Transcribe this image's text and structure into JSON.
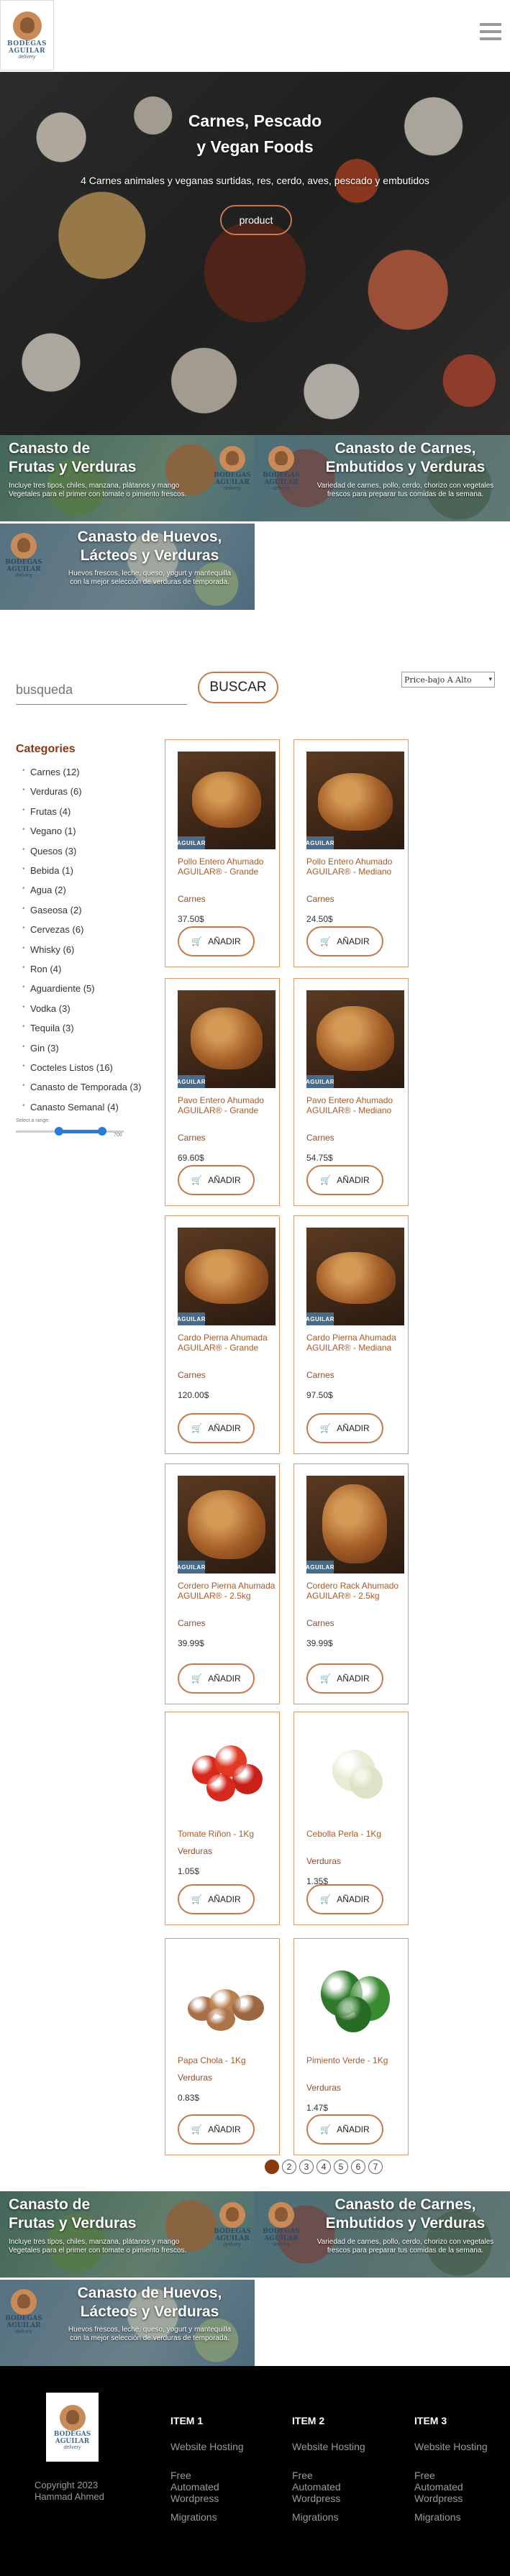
{
  "header": {
    "brand_line1": "BODEGAS",
    "brand_line2": "AGUILAR",
    "brand_line3": "delivery"
  },
  "hero": {
    "title_line1": "Carnes, Pescado",
    "title_line2": "y Vegan Foods",
    "subtitle": "4 Carnes animales y veganas surtidas, res, cerdo, aves, pescado y embutidos",
    "button_label": "product"
  },
  "banners": {
    "fruit": {
      "title_line1": "Canasto de",
      "title_line2": "Frutas y Verduras",
      "subtitle_line1": "Incluye tres tipos, chiles, manzana, plátanos y mango",
      "subtitle_line2": "Vegetales para el primer con tomate o pimiento frescos."
    },
    "meat": {
      "title_line1": "Canasto de Carnes,",
      "title_line2": "Embutidos y Verduras",
      "subtitle_line1": "Variedad de carnes, pollo, cerdo, chorizo con vegetales",
      "subtitle_line2": "frescos para preparar tus comidas de la semana."
    },
    "egg": {
      "title_line1": "Canasto de Huevos,",
      "title_line2": "Lácteos y Verduras",
      "subtitle_line1": "Huevos frescos, leche, queso, yogurt y mantequilla",
      "subtitle_line2": "con la mejor selección de verduras de temporada."
    }
  },
  "search": {
    "placeholder": "busqueda",
    "button_label": "BUSCAR"
  },
  "sort": {
    "selected": "Price-bajo A Alto"
  },
  "categories": {
    "heading": "Categories",
    "items": [
      "Carnes (12)",
      "Verduras (6)",
      "Frutas (4)",
      "Vegano (1)",
      "Quesos (3)",
      "Bebida (1)",
      "Agua (2)",
      "Gaseosa (2)",
      "Cervezas (6)",
      "Whisky (6)",
      "Ron (4)",
      "Aguardiente (5)",
      "Vodka (3)",
      "Tequila (3)",
      "Gin (3)",
      "Cocteles Listos (16)",
      "Canasto de Temporada (3)",
      "Canasto Semanal (4)"
    ],
    "slider_label": "Select a range:",
    "slider_max": "700",
    "slider_low": 0.4,
    "slider_high": 0.8
  },
  "products": [
    {
      "name": "Pollo Entero Ahumado AGUILAR® - Grande",
      "category": "Carnes",
      "price": "37.50$",
      "add": "AÑADIR",
      "badge": "AGUILAR"
    },
    {
      "name": "Pollo Entero Ahumado AGUILAR® - Mediano",
      "category": "Carnes",
      "price": "24.50$",
      "add": "AÑADIR",
      "badge": "AGUILAR"
    },
    {
      "name": "Pavo Entero Ahumado AGUILAR® - Grande",
      "category": "Carnes",
      "price": "69.60$",
      "add": "AÑADIR",
      "badge": "AGUILAR"
    },
    {
      "name": "Pavo Entero Ahumado AGUILAR® - Mediano",
      "category": "Carnes",
      "price": "54.75$",
      "add": "AÑADIR",
      "badge": "AGUILAR"
    },
    {
      "name": "Cardo Pierna Ahumada AGUILAR® - Grande",
      "category": "Carnes",
      "price": "120.00$",
      "add": "AÑADIR",
      "badge": "AGUILAR"
    },
    {
      "name": "Cardo Pierna Ahumada AGUILAR® - Mediana",
      "category": "Carnes",
      "price": "97.50$",
      "add": "AÑADIR",
      "badge": "AGUILAR"
    },
    {
      "name": "Cordero Pierna Ahumada AGUILAR® - 2.5kg",
      "category": "Carnes",
      "price": "39.99$",
      "add": "AÑADIR",
      "badge": "AGUILAR"
    },
    {
      "name": "Cordero Rack Ahumado AGUILAR® - 2.5kg",
      "category": "Carnes",
      "price": "39.99$",
      "add": "AÑADIR",
      "badge": "AGUILAR"
    },
    {
      "name": "Tomate Riñon - 1Kg",
      "category": "Verduras",
      "price": "1.05$",
      "add": "AÑADIR"
    },
    {
      "name": "Cebolla Perla - 1Kg",
      "category": "Verduras",
      "price": "1.35$",
      "add": "AÑADIR"
    },
    {
      "name": "Papa Chola - 1Kg",
      "category": "Verduras",
      "price": "0.83$",
      "add": "AÑADIR"
    },
    {
      "name": "Pimiento Verde - 1Kg",
      "category": "Verduras",
      "price": "1.47$",
      "add": "AÑADIR"
    }
  ],
  "pagination": [
    "1",
    "2",
    "3",
    "4",
    "5",
    "6",
    "7"
  ],
  "footer": {
    "copyright_line1": "Copyright 2023",
    "copyright_line2": "Hammad Ahmed",
    "columns": [
      {
        "title": "ITEM 1",
        "links": [
          "Website Hosting",
          "Free Automated Wordpress",
          "Migrations"
        ]
      },
      {
        "title": "ITEM 2",
        "links": [
          "Website Hosting",
          "Free Automated Wordpress",
          "Migrations"
        ]
      },
      {
        "title": "ITEM 3",
        "links": [
          "Website Hosting",
          "Free Automated Wordpress",
          "Migrations"
        ]
      }
    ]
  },
  "colors": {
    "accent": "#c47a4d",
    "heading": "#8a3a10",
    "product_name": "#a85a2a",
    "brand_blue": "#4a6a8a",
    "footer_bg": "#000000"
  },
  "icons": {
    "menu": "hamburger-menu-icon",
    "cart": "shopping-cart-icon",
    "sort_arrow": "chevron-down-icon",
    "bullet": "bullet-icon"
  }
}
